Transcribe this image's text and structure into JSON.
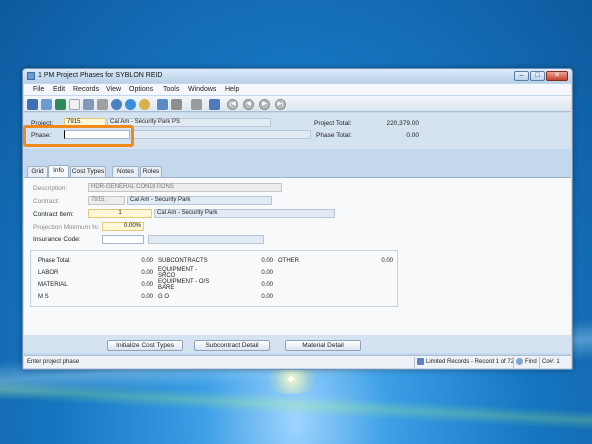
{
  "window": {
    "title": "1 PM Project Phases for SYBLON REID"
  },
  "menu": [
    "File",
    "Edit",
    "Records",
    "View",
    "Options",
    "Tools",
    "Windows",
    "Help"
  ],
  "header": {
    "project_label": "Project:",
    "project_value": "7915.",
    "project_desc": "Cal Am - Security Park PS",
    "project_total_label": "Project Total:",
    "project_total_value": "220,379.00",
    "phase_label": "Phase:",
    "phase_value": "",
    "phase_total_label": "Phase Total:",
    "phase_total_value": "0.00"
  },
  "tabs": [
    "Grid",
    "Info",
    "Cost Types",
    "Notes",
    "Roles"
  ],
  "active_tab": "Info",
  "info": {
    "description_label": "Description:",
    "description_value": "HDR-GENERAL CONDITIONS",
    "contract_label": "Contract:",
    "contract_value": "7915.",
    "contract_desc": "Cal Am - Security Park",
    "contract_item_label": "Contract Item:",
    "contract_item_value": "1",
    "contract_item_desc": "Cal Am - Security Park",
    "projection_label": "Projection Minimum %:",
    "projection_value": "0.00%",
    "insurance_label": "Insurance Code:",
    "insurance_value": ""
  },
  "summary": {
    "phase_total_label": "Phase Total:",
    "phase_total_value": "0.00",
    "labor_label": "LABOR",
    "labor_value": "0.00",
    "material_label": "MATERIAL",
    "material_value": "0.00",
    "ms_label": "M S",
    "ms_value": "0.00",
    "subcontracts_label": "SUBCONTRACTS",
    "subcontracts_value": "0.00",
    "equip_srco_label": "EQUIPMENT - SRCO",
    "equip_srco_value": "0.00",
    "equip_os_label": "EQUIPMENT - O/S BARE",
    "equip_os_value": "0.00",
    "go_label": "G O",
    "go_value": "0.00",
    "other_label": "OTHER",
    "other_value": "0.00"
  },
  "buttons": {
    "initialize": "Initialize Cost Types",
    "subcontract": "Subcontract Detail",
    "material": "Material Detail"
  },
  "status": {
    "hint": "Enter project phase",
    "records": "Limited Records - Record 1 of 72",
    "find": "Find",
    "company": "Co#: 1"
  },
  "colors": {
    "highlight": "#f08a1c",
    "yellow_field": "#fff7d6",
    "window_bg": "#c3d8ec"
  }
}
